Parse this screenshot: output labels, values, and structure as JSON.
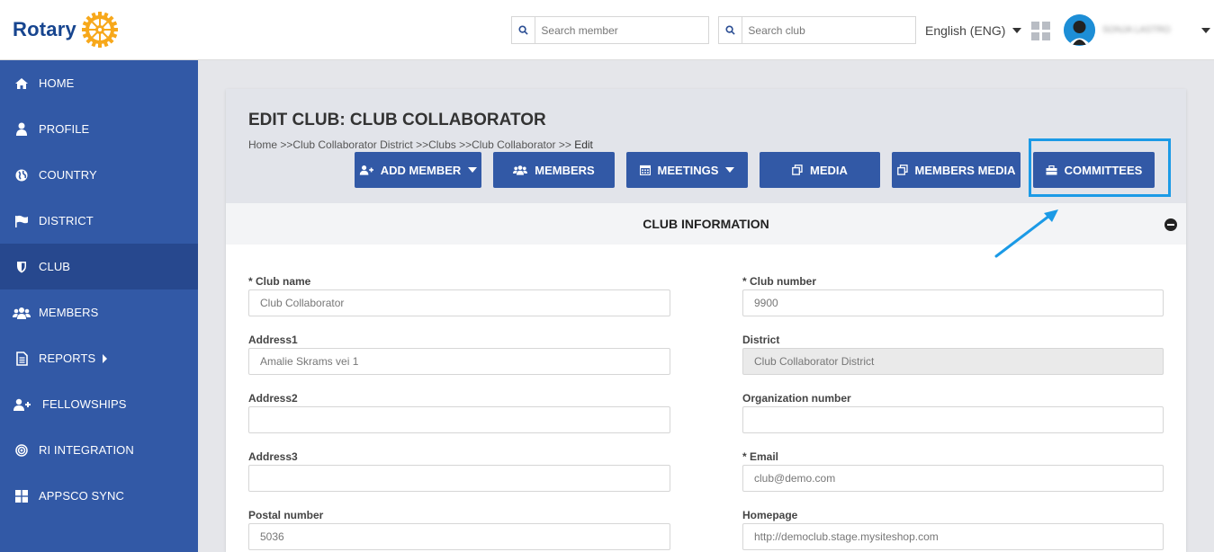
{
  "header": {
    "logo_text": "Rotary",
    "search_member_placeholder": "Search member",
    "search_club_placeholder": "Search club",
    "language": "English (ENG)",
    "user_name": "SONJA LASTRO"
  },
  "sidebar": {
    "items": [
      {
        "label": "HOME",
        "icon": "home-icon"
      },
      {
        "label": "PROFILE",
        "icon": "user-icon"
      },
      {
        "label": "COUNTRY",
        "icon": "globe-icon"
      },
      {
        "label": "DISTRICT",
        "icon": "flag-icon"
      },
      {
        "label": "CLUB",
        "icon": "shield-icon",
        "active": true
      },
      {
        "label": "MEMBERS",
        "icon": "users-icon"
      },
      {
        "label": "REPORTS",
        "icon": "document-icon"
      },
      {
        "label": "FELLOWSHIPS",
        "icon": "user-plus-icon"
      },
      {
        "label": "RI INTEGRATION",
        "icon": "target-icon"
      },
      {
        "label": "APPSCO SYNC",
        "icon": "windows-icon"
      }
    ]
  },
  "page": {
    "title": "EDIT CLUB: CLUB COLLABORATOR",
    "breadcrumb": {
      "home": "Home >>",
      "district": "Club Collaborator District >>",
      "clubs": "Clubs >>",
      "club": "Club Collaborator >>",
      "current": " Edit"
    },
    "buttons": {
      "add_member": "ADD MEMBER",
      "members": "MEMBERS",
      "meetings": "MEETINGS",
      "media": "MEDIA",
      "members_media": "MEMBERS MEDIA",
      "committees": "COMMITTEES"
    },
    "section_title": "CLUB INFORMATION"
  },
  "form": {
    "club_name_label": "* Club name",
    "club_name_value": "Club Collaborator",
    "club_number_label": "* Club number",
    "club_number_value": "9900",
    "address1_label": "Address1",
    "address1_value": "Amalie Skrams vei 1",
    "district_label": "District",
    "district_value": "Club Collaborator District",
    "address2_label": "Address2",
    "address2_value": "",
    "org_number_label": "Organization number",
    "org_number_value": "",
    "address3_label": "Address3",
    "address3_value": "",
    "email_label": "* Email",
    "email_value": "club@demo.com",
    "postal_label": "Postal number",
    "postal_value": "5036",
    "homepage_label": "Homepage",
    "homepage_value": "http://democlub.stage.mysiteshop.com"
  },
  "colors": {
    "sidebar": "#3259a6",
    "sidebar_active": "#27488e",
    "button": "#3259a6",
    "highlight": "#1b9ae6",
    "logo": "#17458f",
    "wheel": "#f7a81b"
  }
}
